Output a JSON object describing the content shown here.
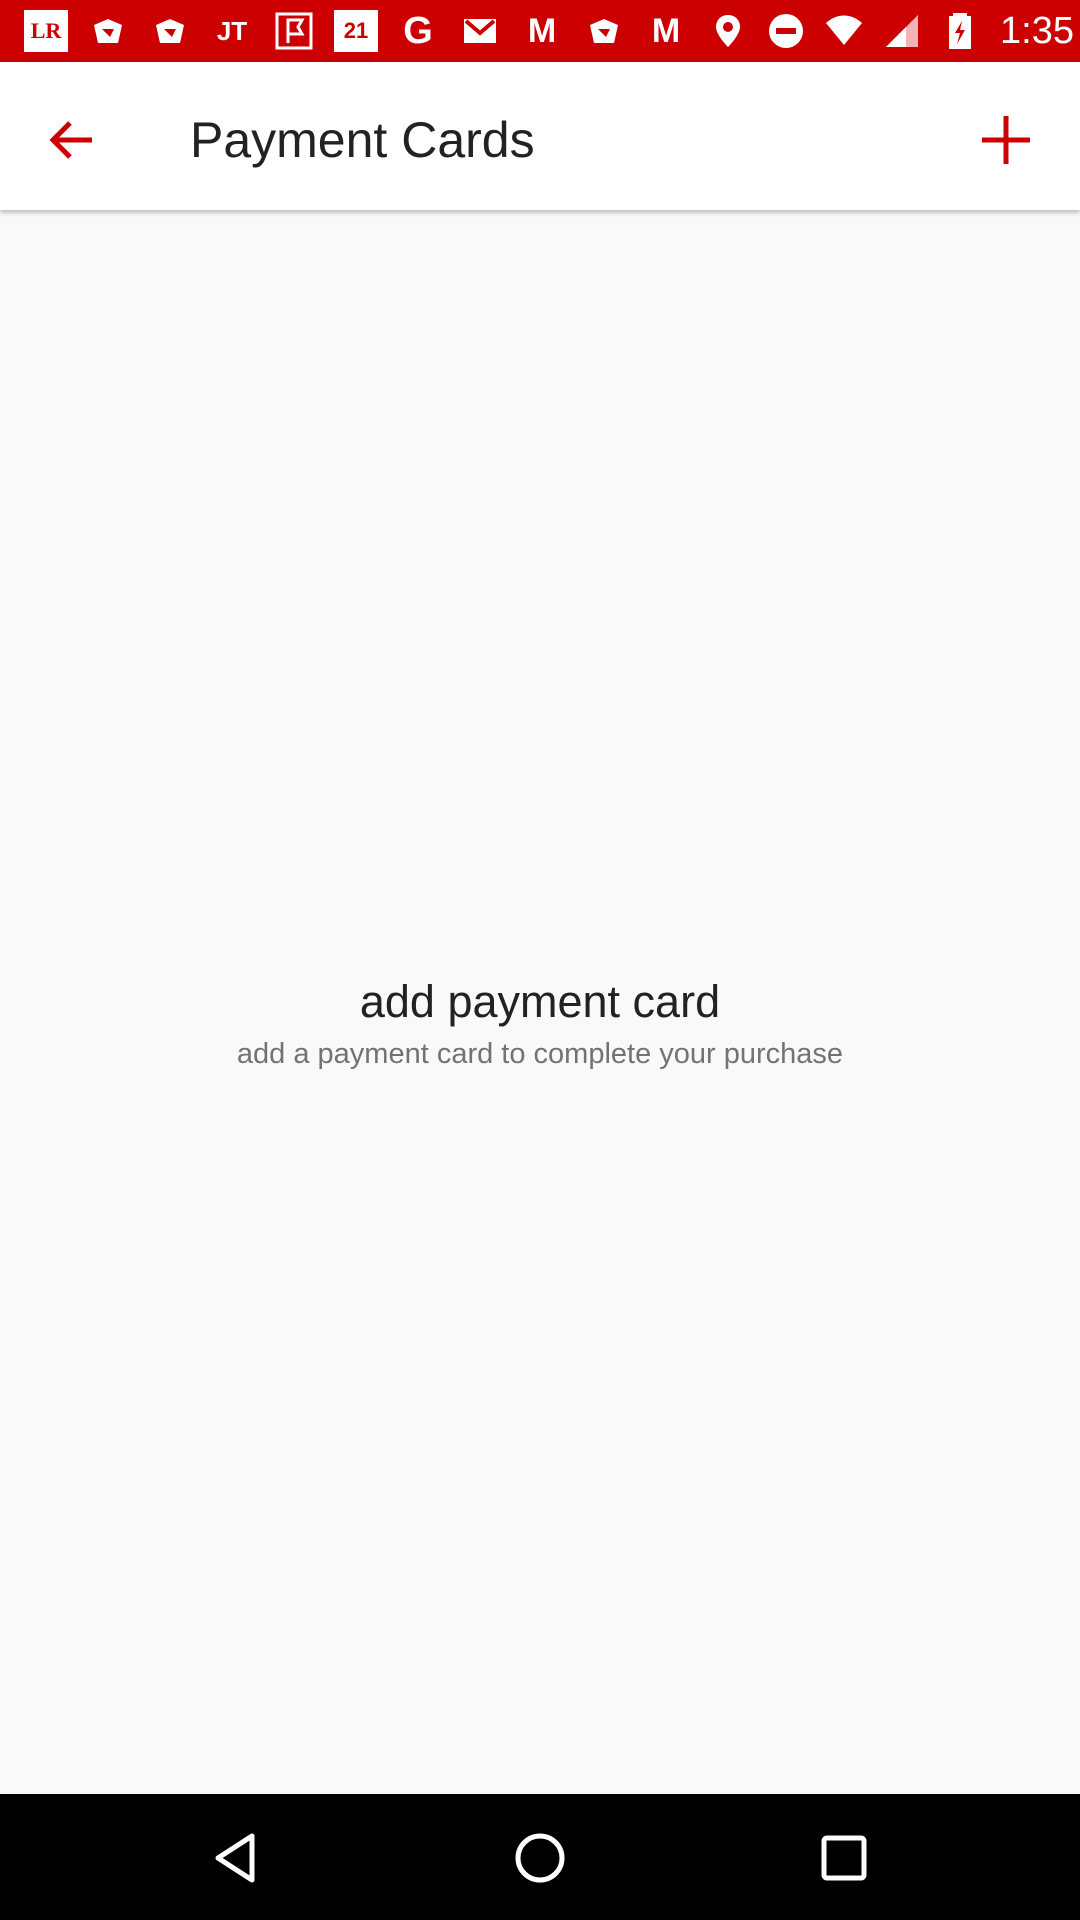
{
  "status_bar": {
    "left_icons": [
      {
        "name": "lr-app-icon",
        "text": "LR"
      },
      {
        "name": "gift-icon",
        "text": ""
      },
      {
        "name": "gift-icon-2",
        "text": ""
      },
      {
        "name": "jt-app-icon",
        "text": "JT"
      },
      {
        "name": "flag-app-icon",
        "text": ""
      },
      {
        "name": "forever21-icon",
        "text": "21"
      },
      {
        "name": "google-icon",
        "text": "G"
      },
      {
        "name": "gmail-icon",
        "text": ""
      },
      {
        "name": "m-app-icon",
        "text": "M"
      },
      {
        "name": "gift-icon-3",
        "text": ""
      },
      {
        "name": "m-app-icon-2",
        "text": "M"
      }
    ],
    "time": "1:35"
  },
  "app_bar": {
    "title": "Payment Cards"
  },
  "empty_state": {
    "title": "add payment card",
    "subtitle": "add a payment card to complete your purchase"
  },
  "colors": {
    "accent": "#cc0000",
    "background": "#f9f9f9",
    "title_text": "#222222",
    "subtitle_text": "#737373"
  }
}
